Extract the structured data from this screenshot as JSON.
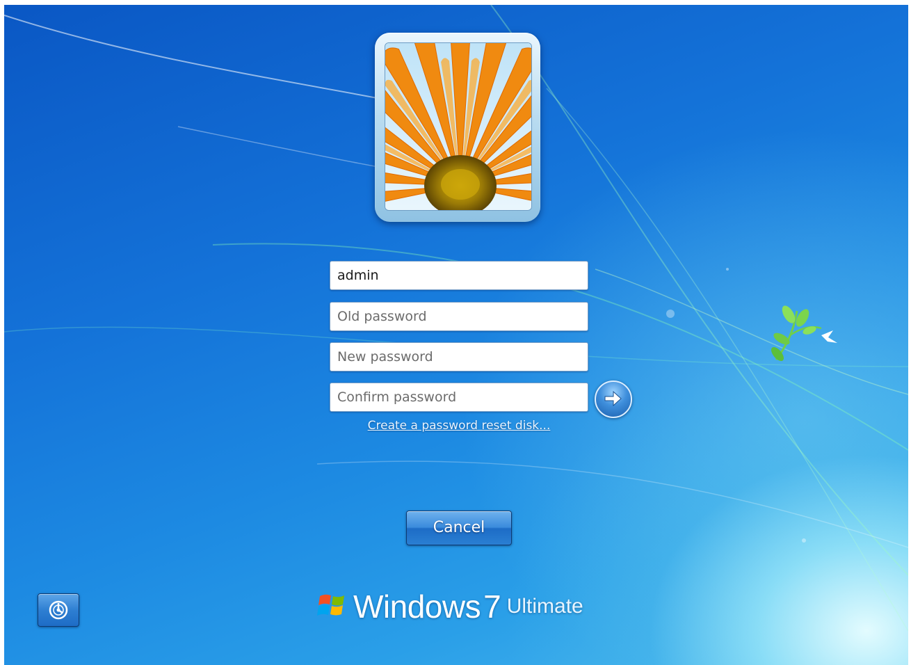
{
  "login": {
    "username": "admin",
    "old_password_placeholder": "Old password",
    "new_password_placeholder": "New password",
    "confirm_password_placeholder": "Confirm password",
    "reset_disk_link": "Create a password reset disk...",
    "cancel_label": "Cancel"
  },
  "brand": {
    "windows": "Windows",
    "version": "7",
    "edition": "Ultimate"
  },
  "icons": {
    "user_tile": "orange-flower-picture",
    "submit": "arrow-right-icon",
    "ease_of_access": "ease-of-access-icon",
    "logo": "windows-flag-icon"
  },
  "colors": {
    "background": "#1472d8",
    "button": "#2e7fd2"
  }
}
